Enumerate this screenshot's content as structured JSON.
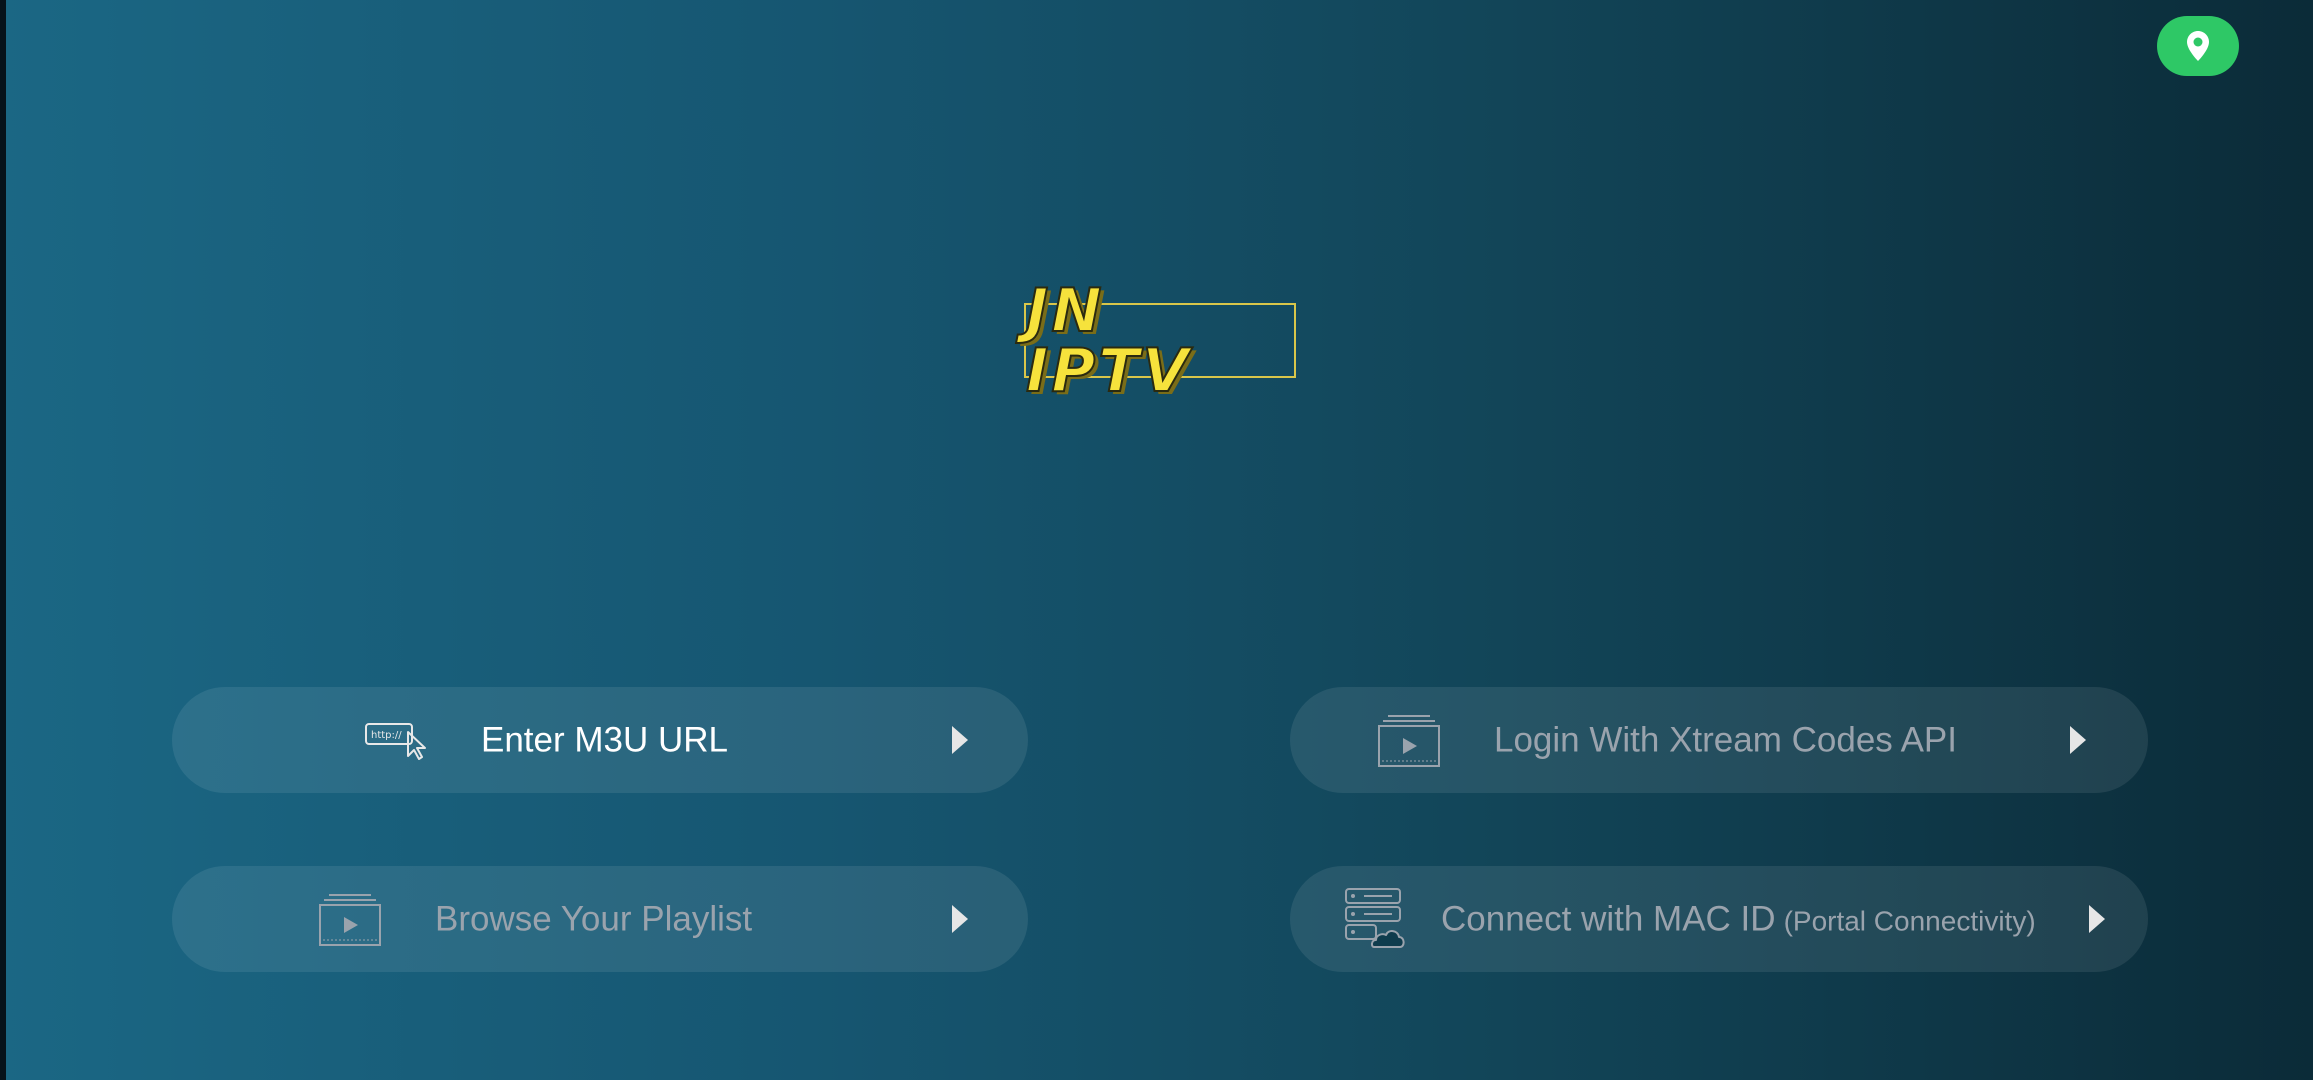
{
  "app": {
    "logo_text": "JN IPTV"
  },
  "header": {
    "location_icon": "location-pin-icon",
    "location_color": "#2ec866"
  },
  "menu": {
    "m3u": {
      "label": "Enter M3U URL",
      "icon": "http-cursor-icon",
      "icon_text": "http://"
    },
    "xtream": {
      "label": "Login With Xtream Codes API",
      "icon": "video-playlist-icon"
    },
    "playlist": {
      "label": "Browse Your Playlist",
      "icon": "video-playlist-icon"
    },
    "mac": {
      "label": "Connect with MAC ID",
      "sub_label": "(Portal Connectivity)",
      "icon": "server-cloud-icon"
    }
  },
  "colors": {
    "accent_logo": "#f6e23c",
    "active_text": "#ffffff",
    "inactive_text": "#9aa3ad"
  }
}
